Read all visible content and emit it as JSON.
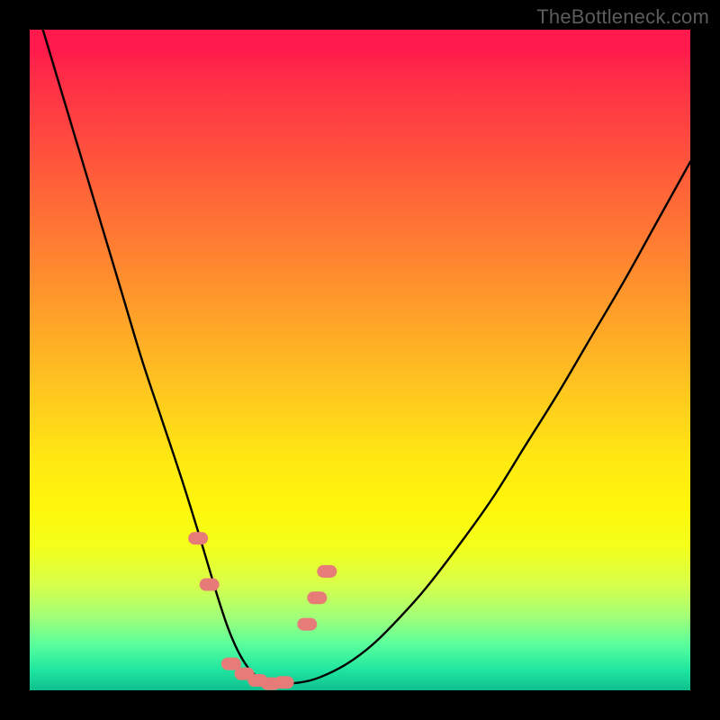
{
  "watermark": {
    "text": "TheBottleneck.com"
  },
  "colors": {
    "frame": "#000000",
    "curve_stroke": "#000000",
    "point_fill": "#e77b77",
    "gradient_top": "#ff1a4b",
    "gradient_bottom": "#0fbf8e"
  },
  "chart_data": {
    "type": "line",
    "title": "",
    "xlabel": "",
    "ylabel": "",
    "xlim": [
      0,
      100
    ],
    "ylim": [
      0,
      100
    ],
    "grid": false,
    "legend": false,
    "annotations": [],
    "series": [
      {
        "name": "bottleneck-curve",
        "x": [
          2,
          5,
          8,
          11,
          14,
          17,
          20,
          23,
          25.5,
          27,
          28.5,
          30,
          31.5,
          33,
          34.5,
          36,
          38,
          41,
          44,
          48,
          52,
          56,
          60,
          65,
          70,
          75,
          80,
          85,
          90,
          95,
          100
        ],
        "values": [
          100,
          90,
          80,
          70,
          60,
          50,
          41,
          32,
          24,
          19,
          14,
          9.5,
          6,
          3.5,
          2,
          1.2,
          1,
          1.2,
          2,
          4,
          7,
          11,
          15.5,
          22,
          29,
          37,
          45,
          53.5,
          62,
          71,
          80
        ]
      }
    ],
    "points": [
      {
        "name": "pt-left-high",
        "x": 25.5,
        "y": 23
      },
      {
        "name": "pt-left-low",
        "x": 27.2,
        "y": 16
      },
      {
        "name": "pt-trough-1",
        "x": 30.5,
        "y": 4
      },
      {
        "name": "pt-trough-2",
        "x": 32.5,
        "y": 2.5
      },
      {
        "name": "pt-trough-3",
        "x": 34.5,
        "y": 1.5
      },
      {
        "name": "pt-trough-4",
        "x": 36.5,
        "y": 1
      },
      {
        "name": "pt-trough-5",
        "x": 38.5,
        "y": 1.2
      },
      {
        "name": "pt-right-low",
        "x": 42.0,
        "y": 10
      },
      {
        "name": "pt-right-mid",
        "x": 43.5,
        "y": 14
      },
      {
        "name": "pt-right-high",
        "x": 45.0,
        "y": 18
      }
    ]
  }
}
